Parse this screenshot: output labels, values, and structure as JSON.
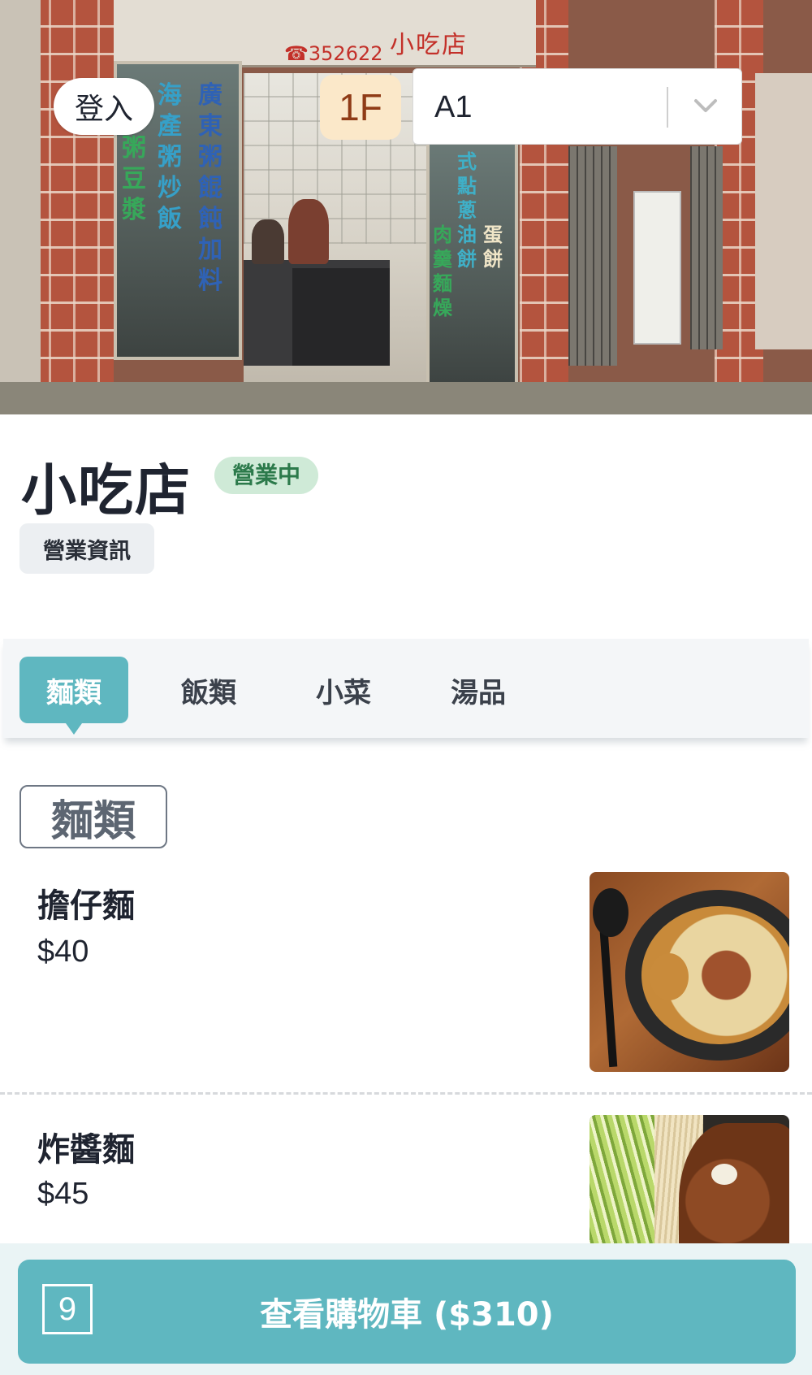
{
  "hero": {
    "sign_text": "小吃店",
    "phone_text": "☎352622",
    "glass_left_col1": [
      "海",
      "產",
      "粥",
      "炒",
      "飯"
    ],
    "glass_left_col2": [
      "廣",
      "東",
      "粥",
      "餛",
      "飩",
      "加",
      "料"
    ],
    "glass_left_col0": [
      "粥",
      "豆",
      "漿"
    ],
    "glass_right_col1": [
      "肉",
      "羹",
      "麵",
      "燥"
    ],
    "glass_right_col2": [
      "式",
      "點",
      "蔥",
      "油",
      "餅"
    ],
    "glass_right_col3": [
      "蛋",
      "餅"
    ]
  },
  "header": {
    "login_label": "登入",
    "floor_label": "1F",
    "table_value": "A1"
  },
  "shop": {
    "name": "小吃店",
    "status": "營業中",
    "info_label": "營業資訊"
  },
  "tabs": [
    {
      "label": "麵類",
      "active": true
    },
    {
      "label": "飯類",
      "active": false
    },
    {
      "label": "小菜",
      "active": false
    },
    {
      "label": "湯品",
      "active": false
    }
  ],
  "menu": {
    "section_title": "麵類",
    "items": [
      {
        "name": "擔仔麵",
        "price": "$40"
      },
      {
        "name": "炸醬麵",
        "price": "$45"
      }
    ]
  },
  "cart": {
    "count": "9",
    "label": "查看購物車 ($310)"
  },
  "colors": {
    "accent": "#5fb7c0",
    "status_bg": "#cfead7",
    "status_text": "#2c7a4b",
    "floor_badge_bg": "#fbe8c9",
    "floor_badge_text": "#8f3b16"
  }
}
